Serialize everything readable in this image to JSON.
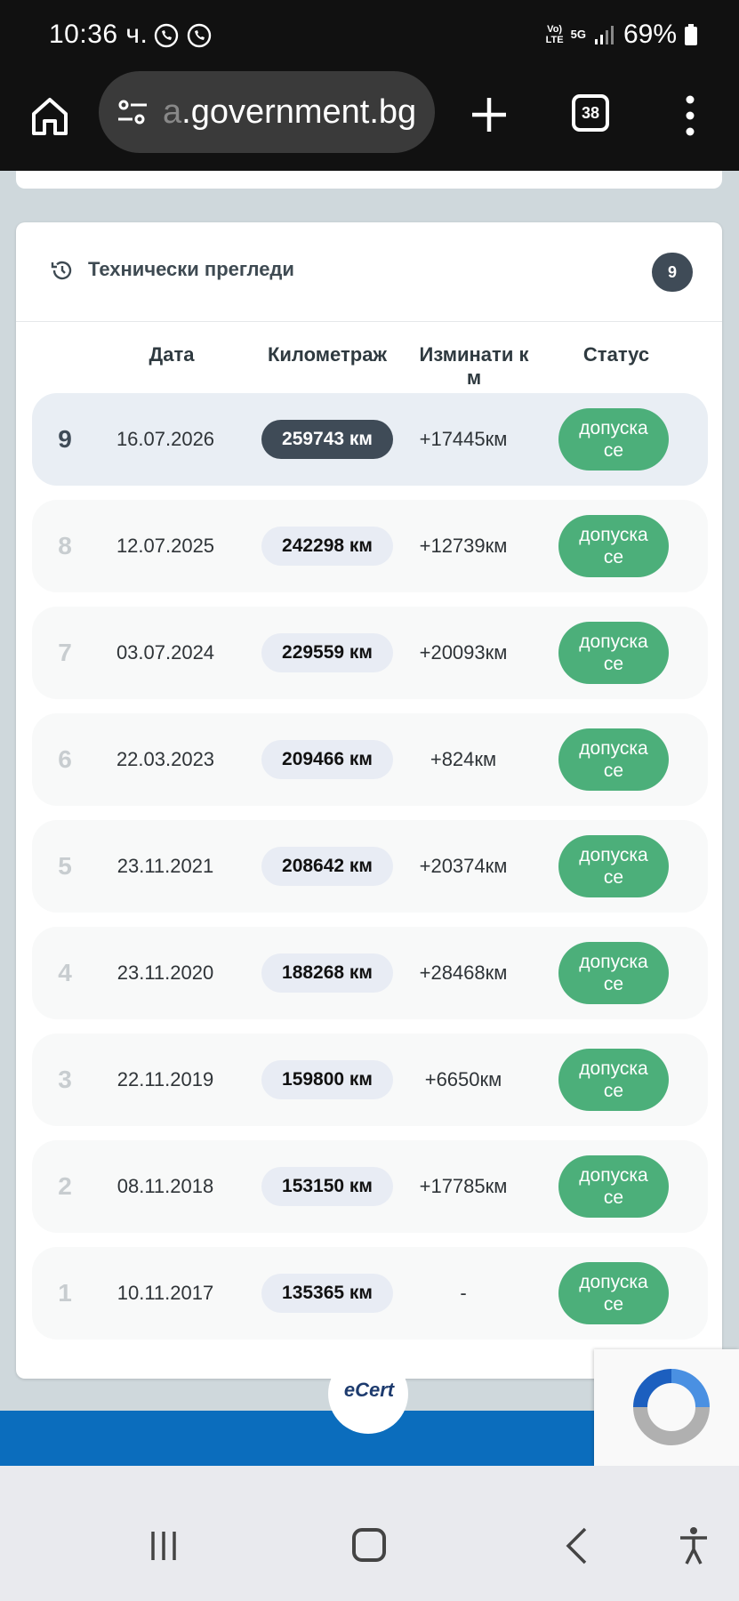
{
  "status_bar": {
    "time": "10:36 ч.",
    "network_top": "Vo)",
    "network_bottom": "LTE",
    "network_5g": "5G",
    "battery": "69%"
  },
  "browser": {
    "url_faded": "a",
    "url_main": ".government.bg",
    "tab_count": "38",
    "icons": [
      "home-icon",
      "tune-icon",
      "plus-icon",
      "tabs-icon",
      "more-vert-icon"
    ]
  },
  "card": {
    "title": "Технически прегледи",
    "count": "9",
    "headers": {
      "date": "Дата",
      "km": "Километраж",
      "diff_line1": "Изминати к",
      "diff_line2": "м",
      "status": "Статус"
    },
    "rows": [
      {
        "num": "9",
        "date": "16.07.2026",
        "km": "259743 км",
        "diff": "+17445км",
        "status_line1": "допуска",
        "status_line2": "се"
      },
      {
        "num": "8",
        "date": "12.07.2025",
        "km": "242298 км",
        "diff": "+12739км",
        "status_line1": "допуска",
        "status_line2": "се"
      },
      {
        "num": "7",
        "date": "03.07.2024",
        "km": "229559 км",
        "diff": "+20093км",
        "status_line1": "допуска",
        "status_line2": "се"
      },
      {
        "num": "6",
        "date": "22.03.2023",
        "km": "209466 км",
        "diff": "+824км",
        "status_line1": "допуска",
        "status_line2": "се"
      },
      {
        "num": "5",
        "date": "23.11.2021",
        "km": "208642 км",
        "diff": "+20374км",
        "status_line1": "допуска",
        "status_line2": "се"
      },
      {
        "num": "4",
        "date": "23.11.2020",
        "km": "188268 км",
        "diff": "+28468км",
        "status_line1": "допуска",
        "status_line2": "се"
      },
      {
        "num": "3",
        "date": "22.11.2019",
        "km": "159800 км",
        "diff": "+6650км",
        "status_line1": "допуска",
        "status_line2": "се"
      },
      {
        "num": "2",
        "date": "08.11.2018",
        "km": "153150 км",
        "diff": "+17785км",
        "status_line1": "допуска",
        "status_line2": "се"
      },
      {
        "num": "1",
        "date": "10.11.2017",
        "km": "135365 км",
        "diff": "-",
        "status_line1": "допуска",
        "status_line2": "се"
      }
    ]
  },
  "footer": {
    "logo_text": "eCert"
  },
  "colors": {
    "status_green": "#4caf7a",
    "badge_dark": "#3f4b57",
    "footer_blue": "#0b6dbd"
  }
}
